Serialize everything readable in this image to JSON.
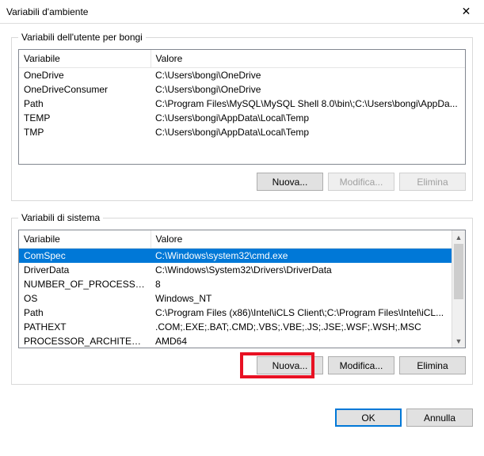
{
  "window": {
    "title": "Variabili d'ambiente",
    "close_glyph": "✕"
  },
  "user_group": {
    "legend": "Variabili dell'utente per bongi",
    "headers": {
      "variable": "Variabile",
      "value": "Valore"
    },
    "rows": [
      {
        "var": "OneDrive",
        "val": "C:\\Users\\bongi\\OneDrive"
      },
      {
        "var": "OneDriveConsumer",
        "val": "C:\\Users\\bongi\\OneDrive"
      },
      {
        "var": "Path",
        "val": "C:\\Program Files\\MySQL\\MySQL Shell 8.0\\bin\\;C:\\Users\\bongi\\AppDa..."
      },
      {
        "var": "TEMP",
        "val": "C:\\Users\\bongi\\AppData\\Local\\Temp"
      },
      {
        "var": "TMP",
        "val": "C:\\Users\\bongi\\AppData\\Local\\Temp"
      }
    ],
    "buttons": {
      "new": "Nuova...",
      "edit": "Modifica...",
      "delete": "Elimina"
    },
    "edit_disabled": true,
    "delete_disabled": true
  },
  "system_group": {
    "legend": "Variabili di sistema",
    "headers": {
      "variable": "Variabile",
      "value": "Valore"
    },
    "rows": [
      {
        "var": "ComSpec",
        "val": "C:\\Windows\\system32\\cmd.exe",
        "selected": true
      },
      {
        "var": "DriverData",
        "val": "C:\\Windows\\System32\\Drivers\\DriverData"
      },
      {
        "var": "NUMBER_OF_PROCESSORS",
        "val": "8"
      },
      {
        "var": "OS",
        "val": "Windows_NT"
      },
      {
        "var": "Path",
        "val": "C:\\Program Files (x86)\\Intel\\iCLS Client\\;C:\\Program Files\\Intel\\iCL..."
      },
      {
        "var": "PATHEXT",
        "val": ".COM;.EXE;.BAT;.CMD;.VBS;.VBE;.JS;.JSE;.WSF;.WSH;.MSC"
      },
      {
        "var": "PROCESSOR_ARCHITECTURE",
        "val": "AMD64"
      }
    ],
    "buttons": {
      "new": "Nuova...",
      "edit": "Modifica...",
      "delete": "Elimina"
    }
  },
  "footer": {
    "ok": "OK",
    "cancel": "Annulla"
  },
  "scrollbar": {
    "up": "▲",
    "down": "▼"
  }
}
